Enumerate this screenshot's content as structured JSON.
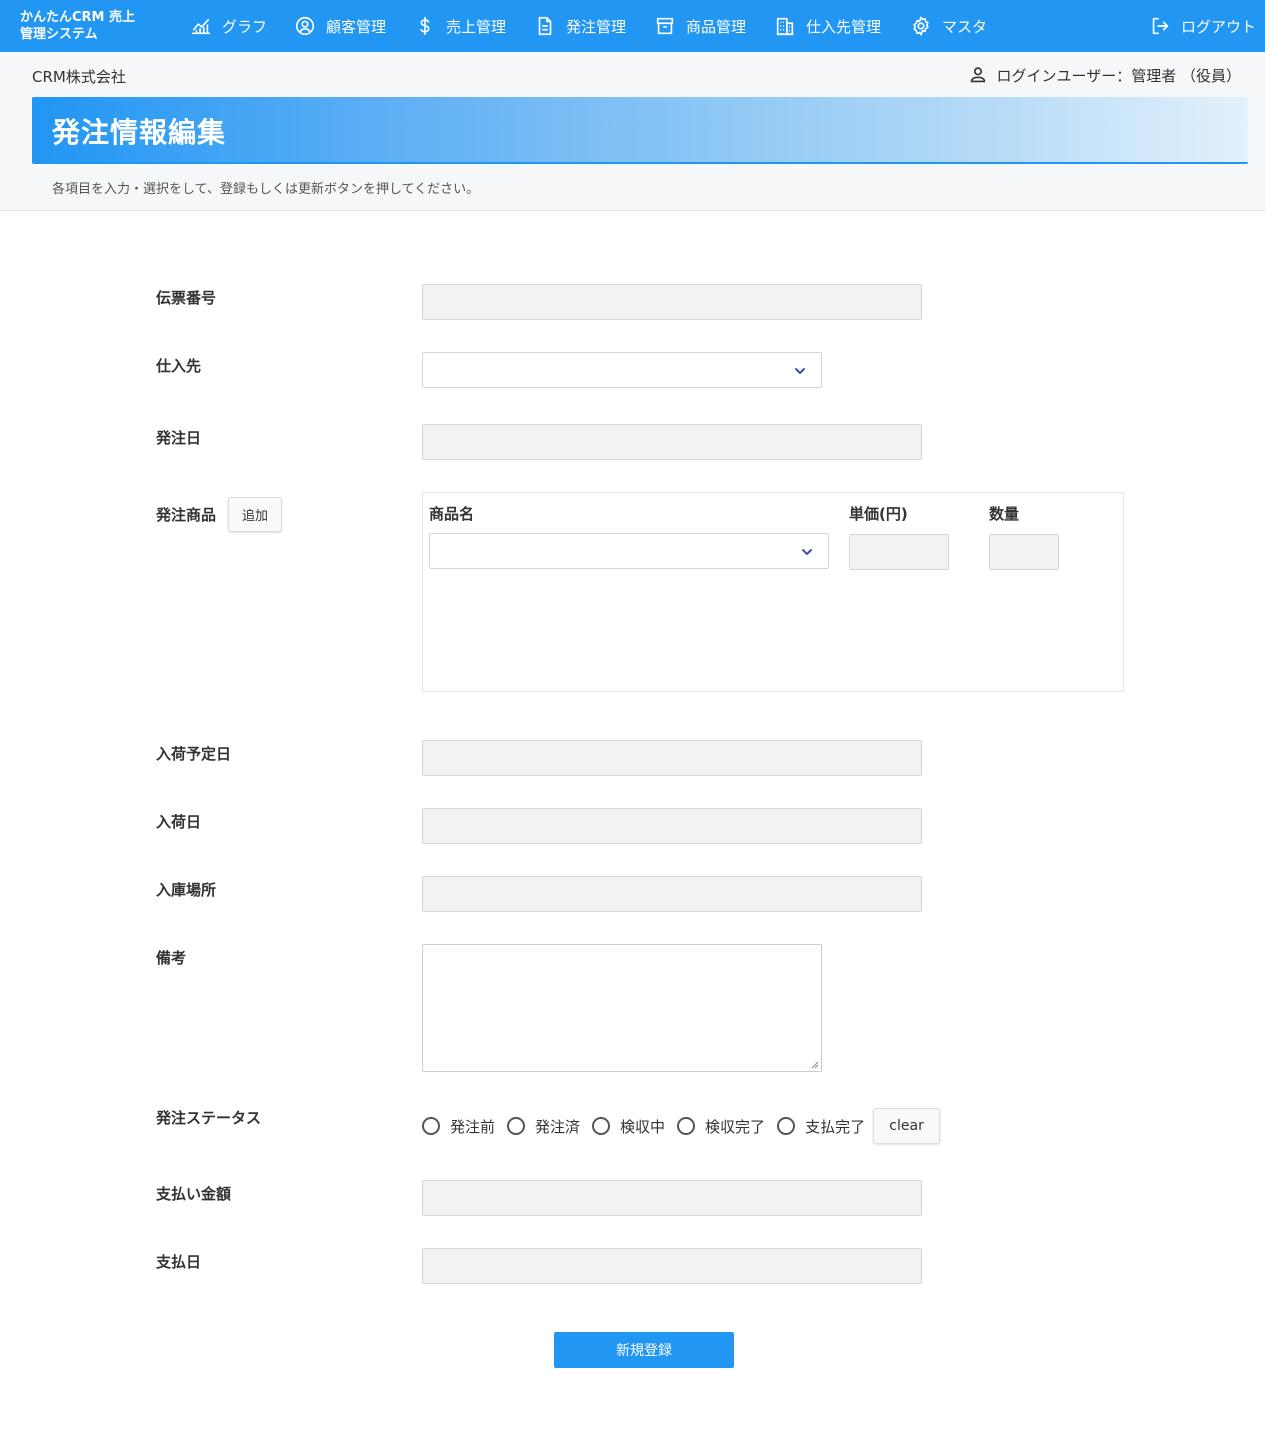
{
  "app": {
    "brand_line1": "かんたんCRM 売上",
    "brand_line2": "管理システム"
  },
  "nav": {
    "items": [
      {
        "label": "グラフ",
        "icon": "chart-icon"
      },
      {
        "label": "顧客管理",
        "icon": "user-circle-icon"
      },
      {
        "label": "売上管理",
        "icon": "dollar-icon"
      },
      {
        "label": "発注管理",
        "icon": "document-icon"
      },
      {
        "label": "商品管理",
        "icon": "archive-box-icon"
      },
      {
        "label": "仕入先管理",
        "icon": "building-icon"
      },
      {
        "label": "マスタ",
        "icon": "gear-icon"
      }
    ],
    "logout": "ログアウト"
  },
  "header": {
    "company": "CRM株式会社",
    "login_user": "ログインユーザー：管理者 （役員）",
    "page_title": "発注情報編集",
    "instructions": "各項目を入力・選択をして、登録もしくは更新ボタンを押してください。"
  },
  "form": {
    "slip_number": {
      "label": "伝票番号",
      "value": ""
    },
    "supplier": {
      "label": "仕入先",
      "selected": ""
    },
    "order_date": {
      "label": "発注日",
      "value": ""
    },
    "order_products": {
      "label": "発注商品",
      "add_button": "追加",
      "columns": {
        "product_name": "商品名",
        "unit_price": "単価(円)",
        "quantity": "数量"
      },
      "rows": [
        {
          "product_name": "",
          "unit_price": "",
          "quantity": ""
        }
      ]
    },
    "expected_arrival_date": {
      "label": "入荷予定日",
      "value": ""
    },
    "arrival_date": {
      "label": "入荷日",
      "value": ""
    },
    "warehouse": {
      "label": "入庫場所",
      "value": ""
    },
    "notes": {
      "label": "備考",
      "value": ""
    },
    "status": {
      "label": "発注ステータス",
      "options": [
        "発注前",
        "発注済",
        "検収中",
        "検収完了",
        "支払完了"
      ],
      "selected": null,
      "clear_button": "clear"
    },
    "payment_amount": {
      "label": "支払い金額",
      "value": ""
    },
    "payment_date": {
      "label": "支払日",
      "value": ""
    },
    "submit_button": "新規登録"
  },
  "colors": {
    "primary": "#2196f3",
    "input_bg": "#f1f2f3",
    "header_bg": "#f6f7f8"
  }
}
